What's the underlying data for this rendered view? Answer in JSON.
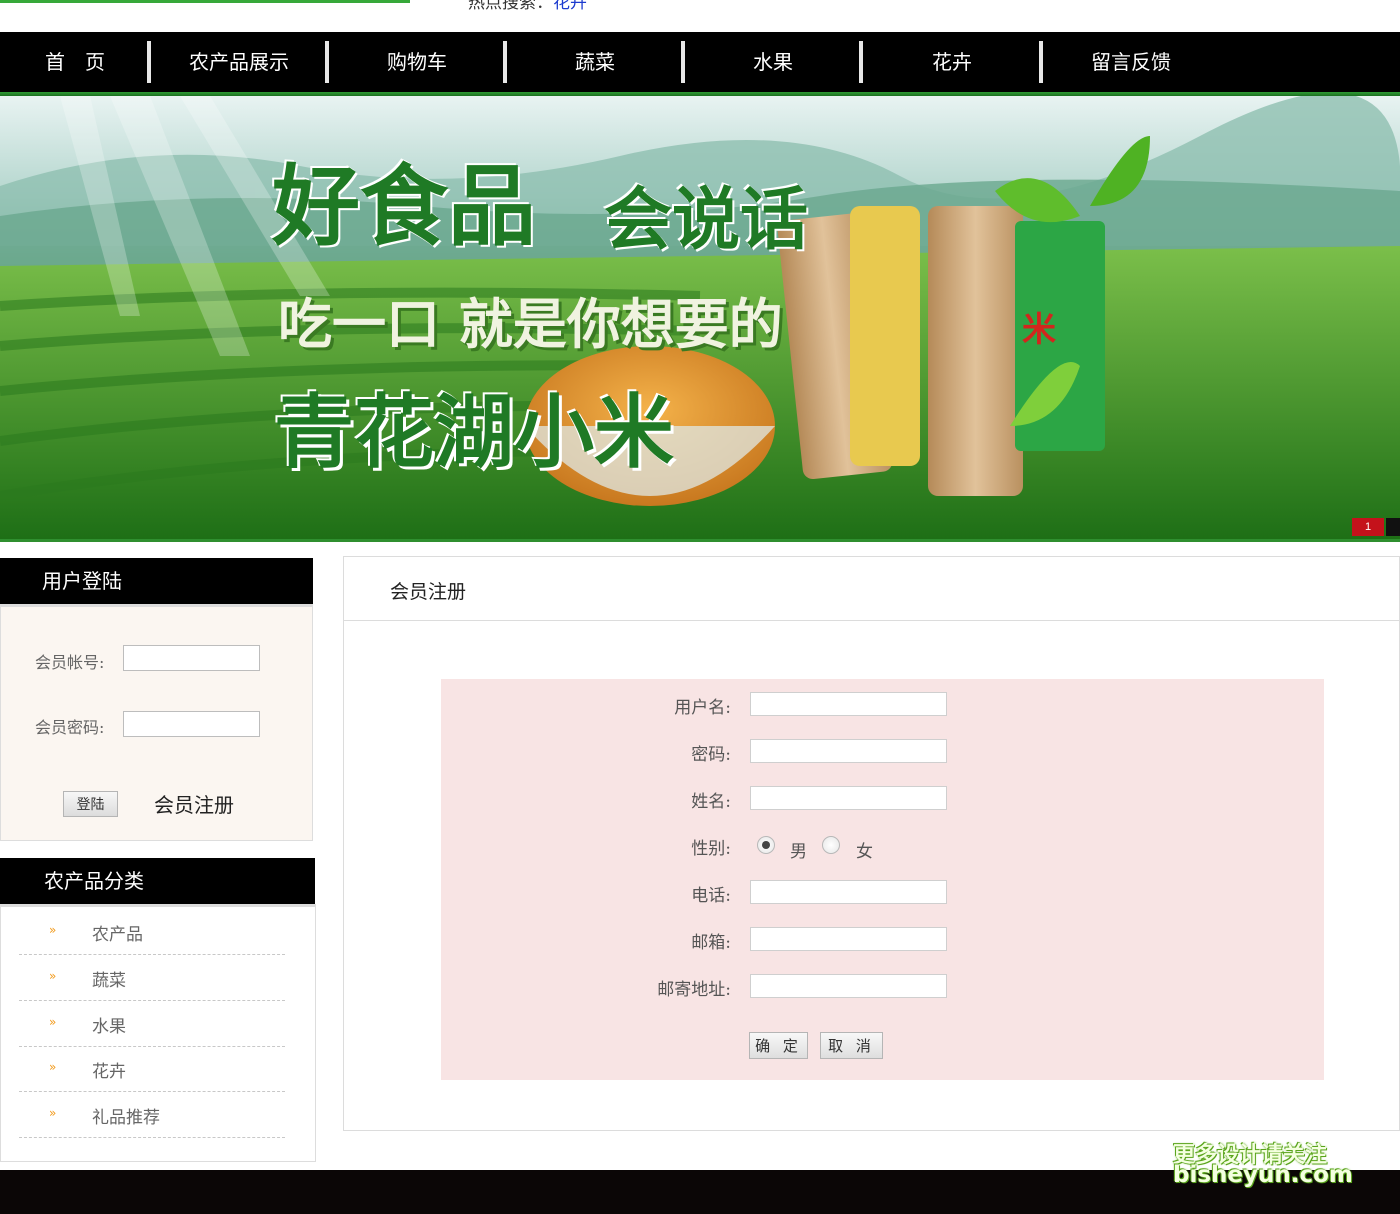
{
  "top": {
    "hot_label": "热点搜索：",
    "hot_link": "花卉"
  },
  "nav": {
    "items": [
      "首　页",
      "农产品展示",
      "购物车",
      "蔬菜",
      "水果",
      "花卉",
      "留言反馈"
    ]
  },
  "banner": {
    "headline1": "好食品",
    "headline2": "会说话",
    "slogan": "吃一口 就是你想要的",
    "brand": "青花湖小米",
    "bag_text": "米",
    "pager": "1"
  },
  "login": {
    "header": "用户登陆",
    "account_label": "会员帐号:",
    "password_label": "会员密码:",
    "login_button": "登陆",
    "register_link": "会员注册"
  },
  "categories": {
    "header": "农产品分类",
    "items": [
      "农产品",
      "蔬菜",
      "水果",
      "花卉",
      "礼品推荐"
    ]
  },
  "register": {
    "title": "会员注册",
    "username_label": "用户名:",
    "password_label": "密码:",
    "name_label": "姓名:",
    "gender_label": "性别:",
    "gender_male": "男",
    "gender_female": "女",
    "gender_selected": "男",
    "phone_label": "电话:",
    "email_label": "邮箱:",
    "address_label": "邮寄地址:",
    "submit_button": "确 定",
    "cancel_button": "取 消"
  },
  "watermark": {
    "line1": "更多设计请关注",
    "line2": "bisheyun.com"
  },
  "colors": {
    "nav_bg": "#000000",
    "accent_green": "#2f8f2f",
    "form_bg": "#f8e4e4",
    "link_blue": "#1d3ccf",
    "pager_red": "#c4121b"
  }
}
